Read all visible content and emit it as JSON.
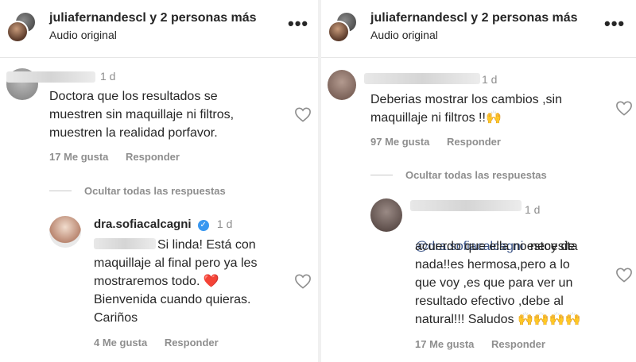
{
  "left": {
    "header": {
      "username": "juliafernandescl",
      "others": "y 2 personas más",
      "subtitle": "Audio original"
    },
    "comment": {
      "time": "1 d",
      "text": "Doctora que los resultados se\nmuestren sin maquillaje ni filtros,\nmuestren la realidad porfavor.",
      "likes": "17 Me gusta",
      "reply": "Responder"
    },
    "hide_replies": "Ocultar todas las respuestas",
    "reply": {
      "username": "dra.sofiacalcagni",
      "time": "1 d",
      "text": "Si linda! Está con\nmaquillaje al final pero ya les\nmostraremos todo. ❤️\nBienvenida cuando quieras.\nCariños",
      "likes": "4 Me gusta",
      "reply": "Responder"
    }
  },
  "right": {
    "header": {
      "username": "juliafernandescl",
      "others": "y 2 personas más",
      "subtitle": "Audio original"
    },
    "comment": {
      "time": "1 d",
      "text": "Deberias mostrar los cambios ,sin\nmaquillaje ni filtros !!🙌",
      "likes": "97 Me gusta",
      "reply": "Responder"
    },
    "hide_replies": "Ocultar todas las respuestas",
    "reply": {
      "time": "1 d",
      "mention": "@dra.sofiacalcagni",
      "text_first": " estoy de",
      "text": "acuerdo que ella no necesita\nnada!!es hermosa,pero a lo\nque voy ,es que para ver un\nresultado efectivo ,debe al\nnatural!!! Saludos 🙌🙌🙌🙌",
      "likes": "17 Me gusta",
      "reply": "Responder"
    }
  },
  "icons": [
    "more-icon",
    "heart-icon",
    "verified-icon"
  ],
  "colors": {
    "text": "#262626",
    "secondary": "#8e8e8e",
    "mention": "#385185",
    "verified": "#3897f0"
  }
}
